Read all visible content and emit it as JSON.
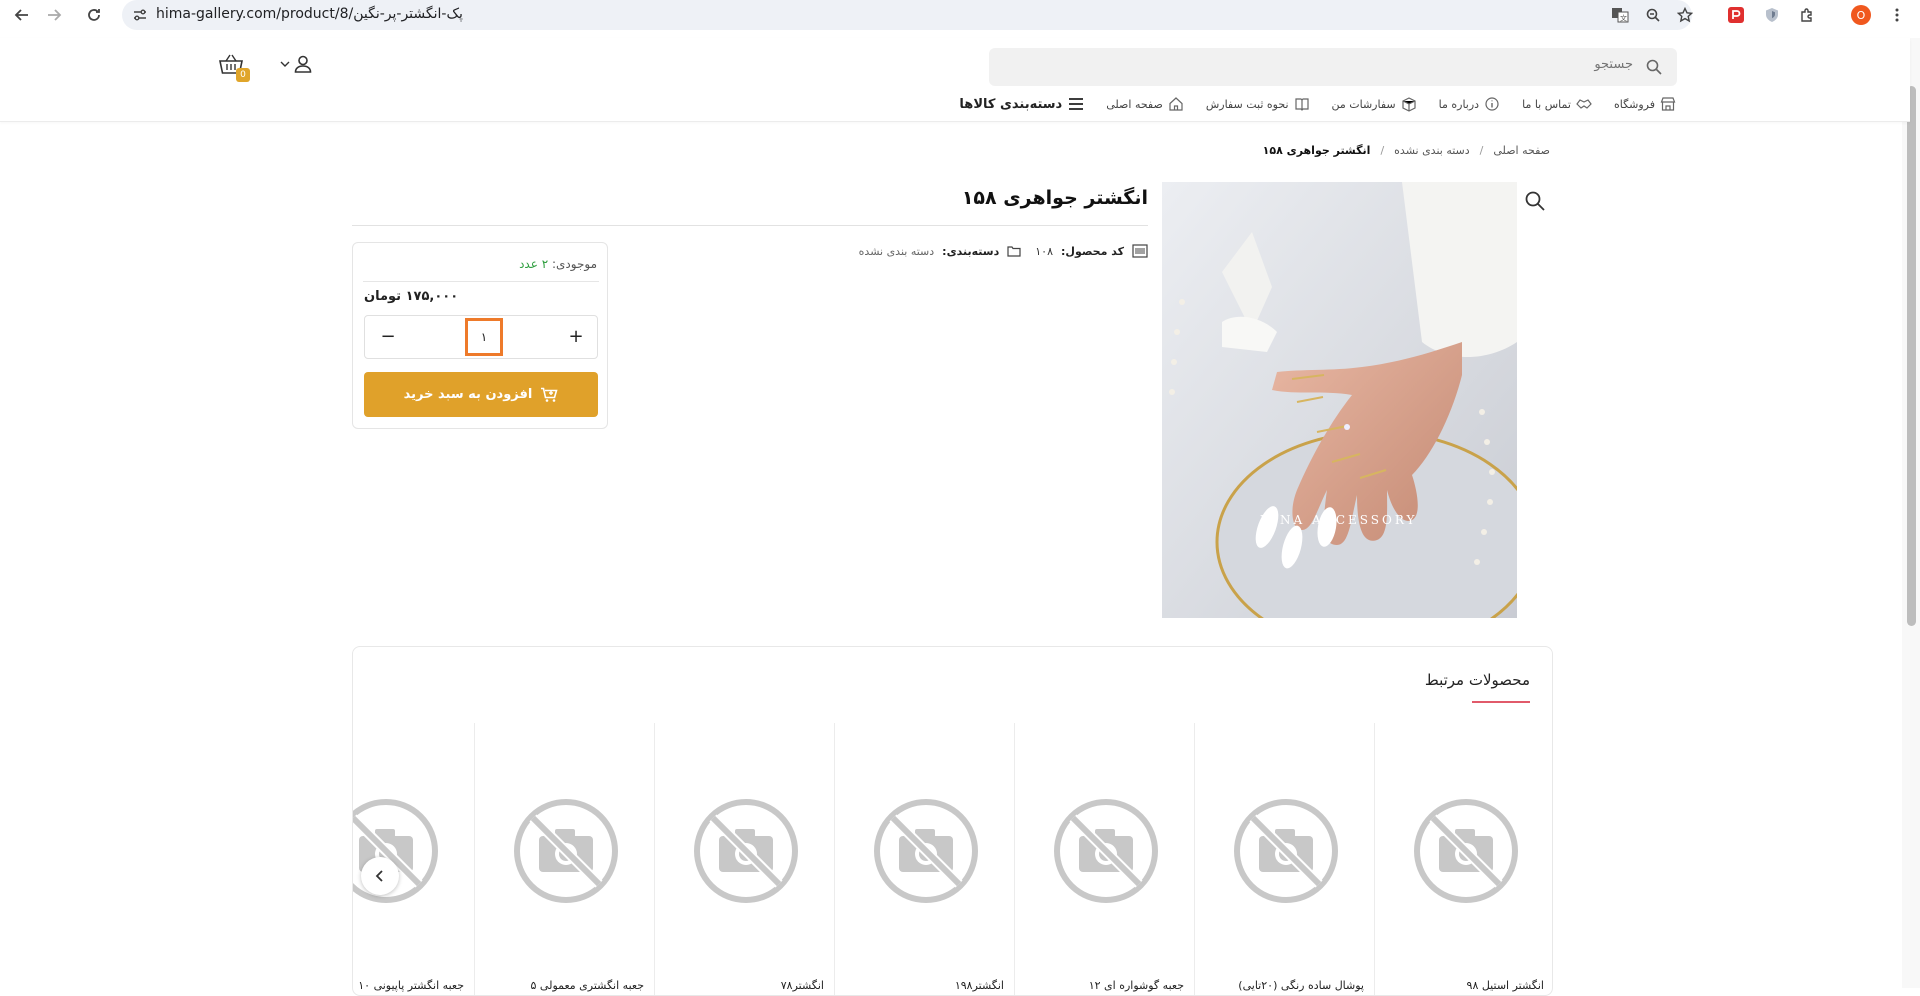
{
  "browser": {
    "url_host": "hima-gallery.com/product/8/",
    "url_slug": "پک-انگشتر-پر-نگین",
    "profile_initial": "O"
  },
  "header": {
    "search_placeholder": "جستجو",
    "cart_count": "0",
    "nav": {
      "categories": "دسته‌بندی کالاها",
      "items": [
        "صفحه اصلی",
        "نحوه ثبت سفارش",
        "سفارشات من",
        "درباره ما",
        "تماس با ما",
        "فروشگاه"
      ]
    }
  },
  "breadcrumb": {
    "home": "صفحه اصلی",
    "category": "دسته بندی نشده",
    "current": "انگشتر جواهری ۱۵۸",
    "separator": "/"
  },
  "product": {
    "title": "انگشتر جواهری ۱۵۸",
    "image_watermark": "VINA ACCESSORY",
    "code_label": "کد محصول:",
    "code_value": "۱۰۸",
    "category_label": "دسته‌بندی:",
    "category_value": "دسته بندی نشده"
  },
  "buybox": {
    "stock_label": "موجودی:",
    "stock_value": "۲ عدد",
    "price": "۱۷۵,۰۰۰ تومان",
    "quantity": "۱",
    "plus": "+",
    "minus": "−",
    "add_to_cart": "افزودن به سبد خرید"
  },
  "related": {
    "title": "محصولات مرتبط",
    "items": [
      {
        "name": "انگشتر استیل ۹۸"
      },
      {
        "name": "پوشال ساده رنگی (۲۰تایی)"
      },
      {
        "name": "جعبه گوشواره ای ۱۲"
      },
      {
        "name": "انگشتر۱۹۸"
      },
      {
        "name": "انگشتر۷۸"
      },
      {
        "name": "جعبه انگشتری معمولی ۵"
      },
      {
        "name": "جعبه انگشتر پاپیونی ۱۰"
      }
    ]
  },
  "colors": {
    "accent": "#e0a12a",
    "stock_green": "#2e9e3f",
    "focus_orange": "#ee7a2a",
    "underline_red": "#e15a6a"
  }
}
